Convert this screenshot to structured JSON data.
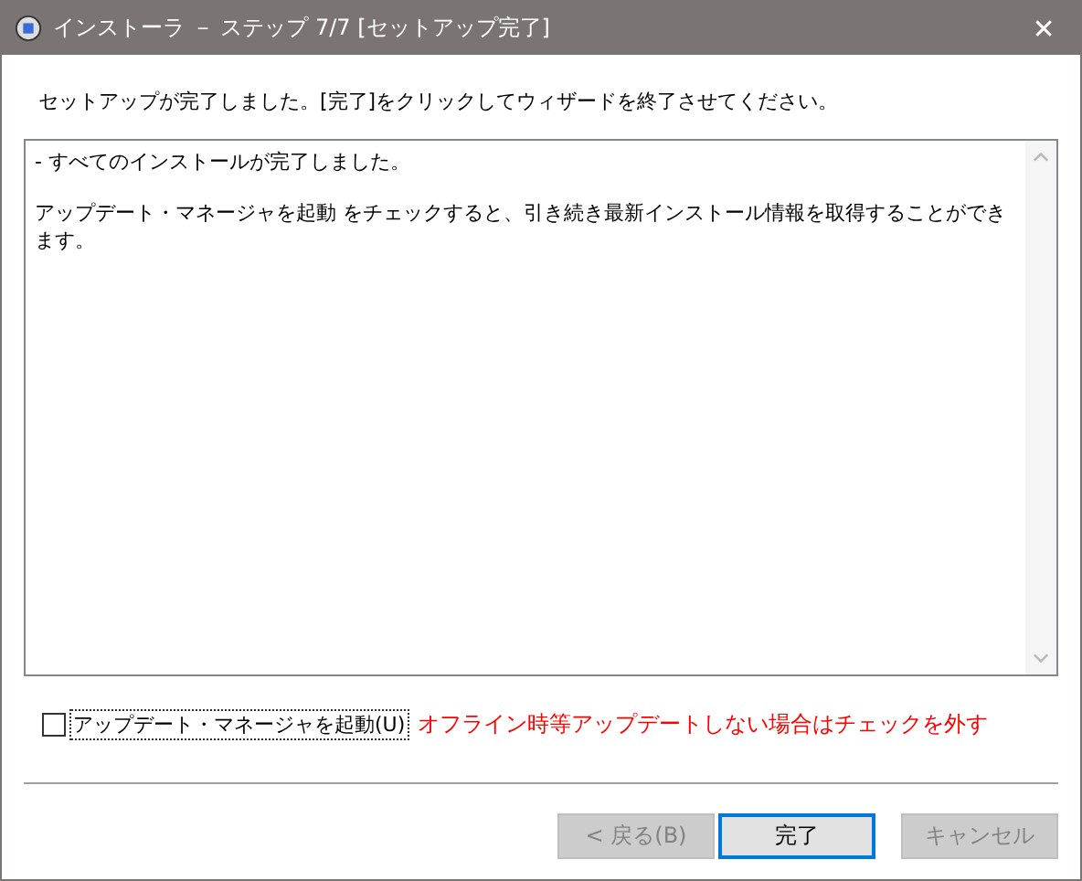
{
  "window": {
    "title": "インストーラ － ステップ 7/7 [セットアップ完了]",
    "close": "✕"
  },
  "instruction": "セットアップが完了しました。[完了]をクリックしてウィザードを終了させてください。",
  "log": {
    "lines": [
      "- すべてのインストールが完了しました。",
      "アップデート・マネージャを起動 をチェックすると、引き続き最新インストール情報を取得することができます。"
    ]
  },
  "option": {
    "label": "アップデート・マネージャを起動(U)",
    "checked": false,
    "note": "オフライン時等アップデートしない場合はチェックを外す"
  },
  "buttons": [
    {
      "label": "< 戻る(B)",
      "disabled": true,
      "focused": false
    },
    {
      "label": "完了",
      "disabled": false,
      "focused": true
    },
    {
      "label": "キャンセル",
      "disabled": true,
      "focused": false
    }
  ]
}
